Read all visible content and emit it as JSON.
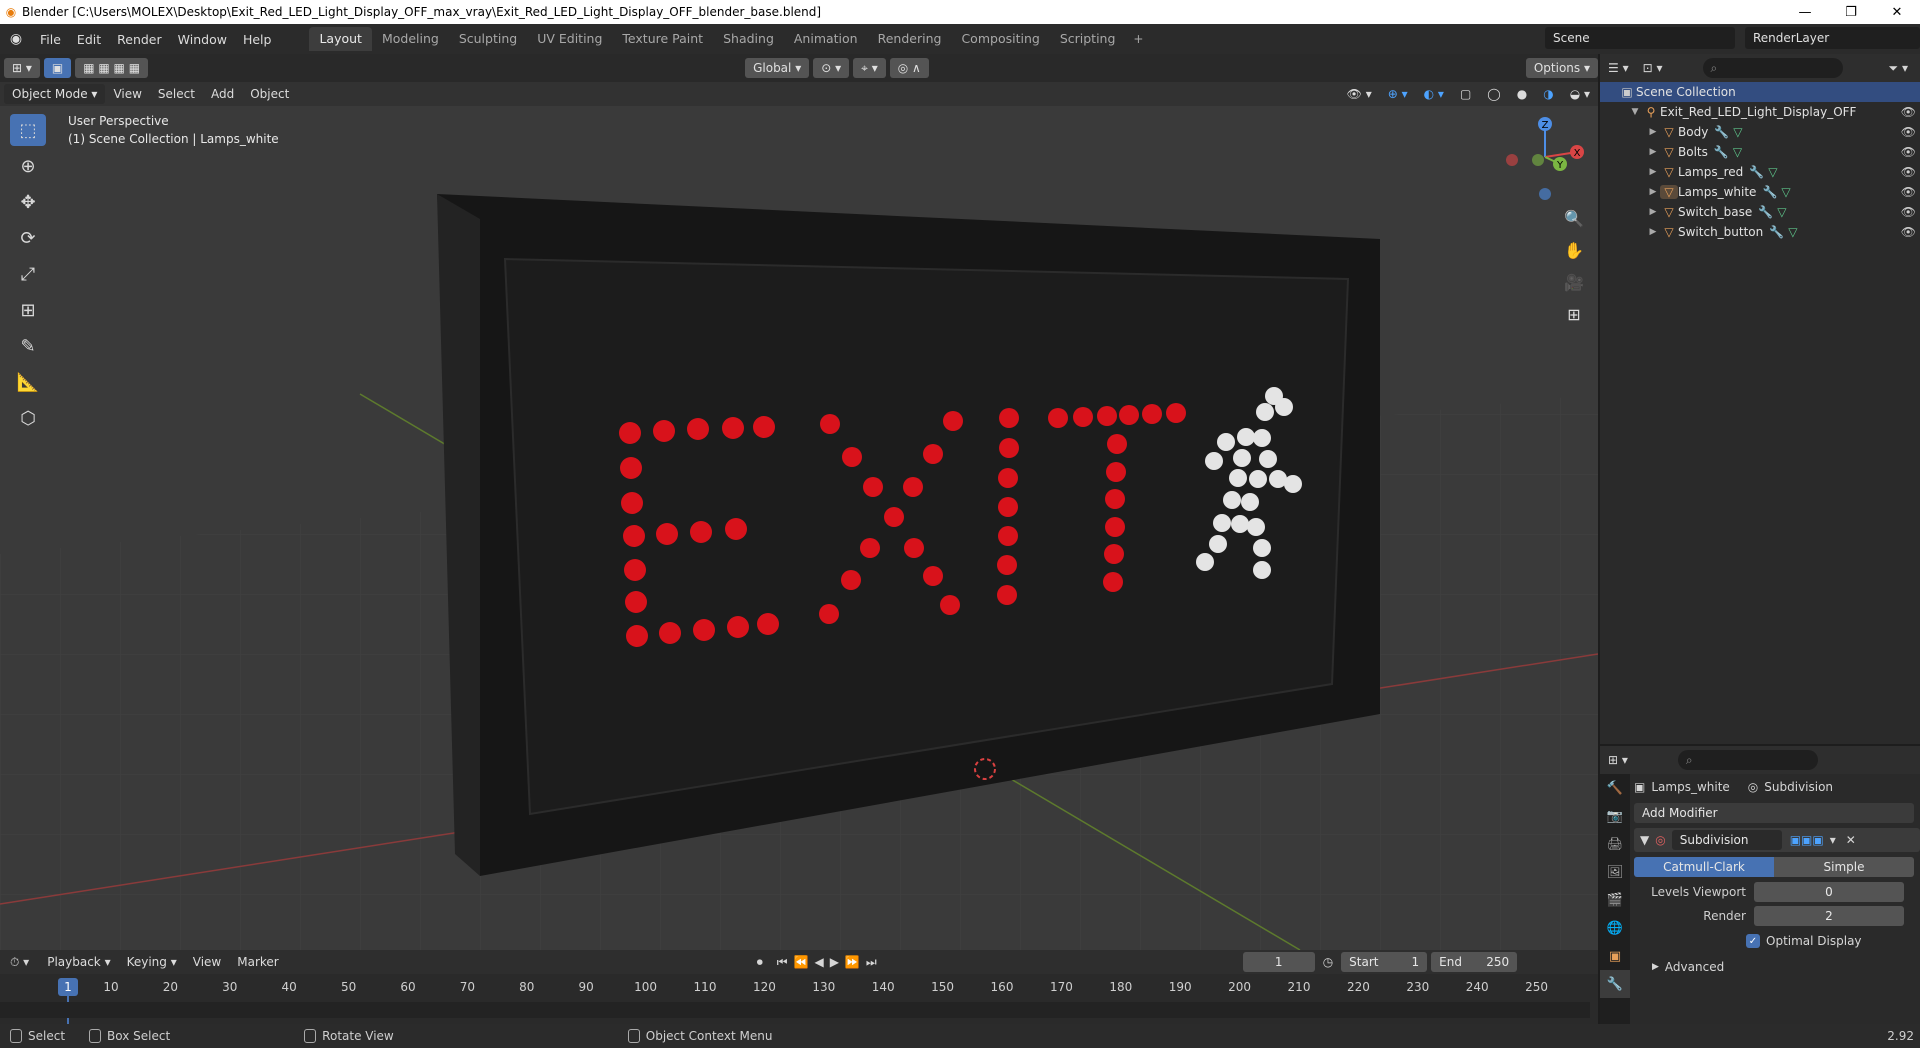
{
  "window": {
    "title": "Blender [C:\\Users\\MOLEX\\Desktop\\Exit_Red_LED_Light_Display_OFF_max_vray\\Exit_Red_LED_Light_Display_OFF_blender_base.blend]",
    "minimize": "—",
    "maximize": "❐",
    "close": "✕"
  },
  "menu": [
    "File",
    "Edit",
    "Render",
    "Window",
    "Help"
  ],
  "workspaces": [
    "Layout",
    "Modeling",
    "Sculpting",
    "UV Editing",
    "Texture Paint",
    "Shading",
    "Animation",
    "Rendering",
    "Compositing",
    "Scripting"
  ],
  "scene": "Scene",
  "render_layer": "RenderLayer",
  "viewport": {
    "mode": "Object Mode",
    "menus": [
      "View",
      "Select",
      "Add",
      "Object"
    ],
    "transform_orientation": "Global",
    "options": "Options",
    "info_line1": "User Perspective",
    "info_line2": "(1) Scene Collection | Lamps_white",
    "exit_text": "EXIT",
    "gizmo": {
      "x": "X",
      "y": "Y",
      "z": "Z"
    }
  },
  "outliner": {
    "root": "Scene Collection",
    "collection": "Exit_Red_LED_Light_Display_OFF",
    "objects": [
      "Body",
      "Bolts",
      "Lamps_red",
      "Lamps_white",
      "Switch_base",
      "Switch_button"
    ]
  },
  "properties": {
    "object_name": "Lamps_white",
    "modifier_label": "Subdivision",
    "add_modifier": "Add Modifier",
    "modifier_name": "Subdivision",
    "catmull": "Catmull-Clark",
    "simple": "Simple",
    "levels_viewport_label": "Levels Viewport",
    "levels_viewport": "0",
    "render_label": "Render",
    "render": "2",
    "optimal_display": "Optimal Display",
    "advanced": "Advanced"
  },
  "timeline": {
    "menus": [
      "Playback",
      "Keying",
      "View",
      "Marker"
    ],
    "current_frame": "1",
    "start_label": "Start",
    "start": "1",
    "end_label": "End",
    "end": "250",
    "ticks": [
      "10",
      "20",
      "30",
      "40",
      "50",
      "60",
      "70",
      "80",
      "90",
      "100",
      "110",
      "120",
      "130",
      "140",
      "150",
      "160",
      "170",
      "180",
      "190",
      "200",
      "210",
      "220",
      "230",
      "240",
      "250"
    ],
    "playhead": "1"
  },
  "status": {
    "select": "Select",
    "box_select": "Box Select",
    "rotate_view": "Rotate View",
    "context_menu": "Object Context Menu",
    "version": "2.92"
  }
}
